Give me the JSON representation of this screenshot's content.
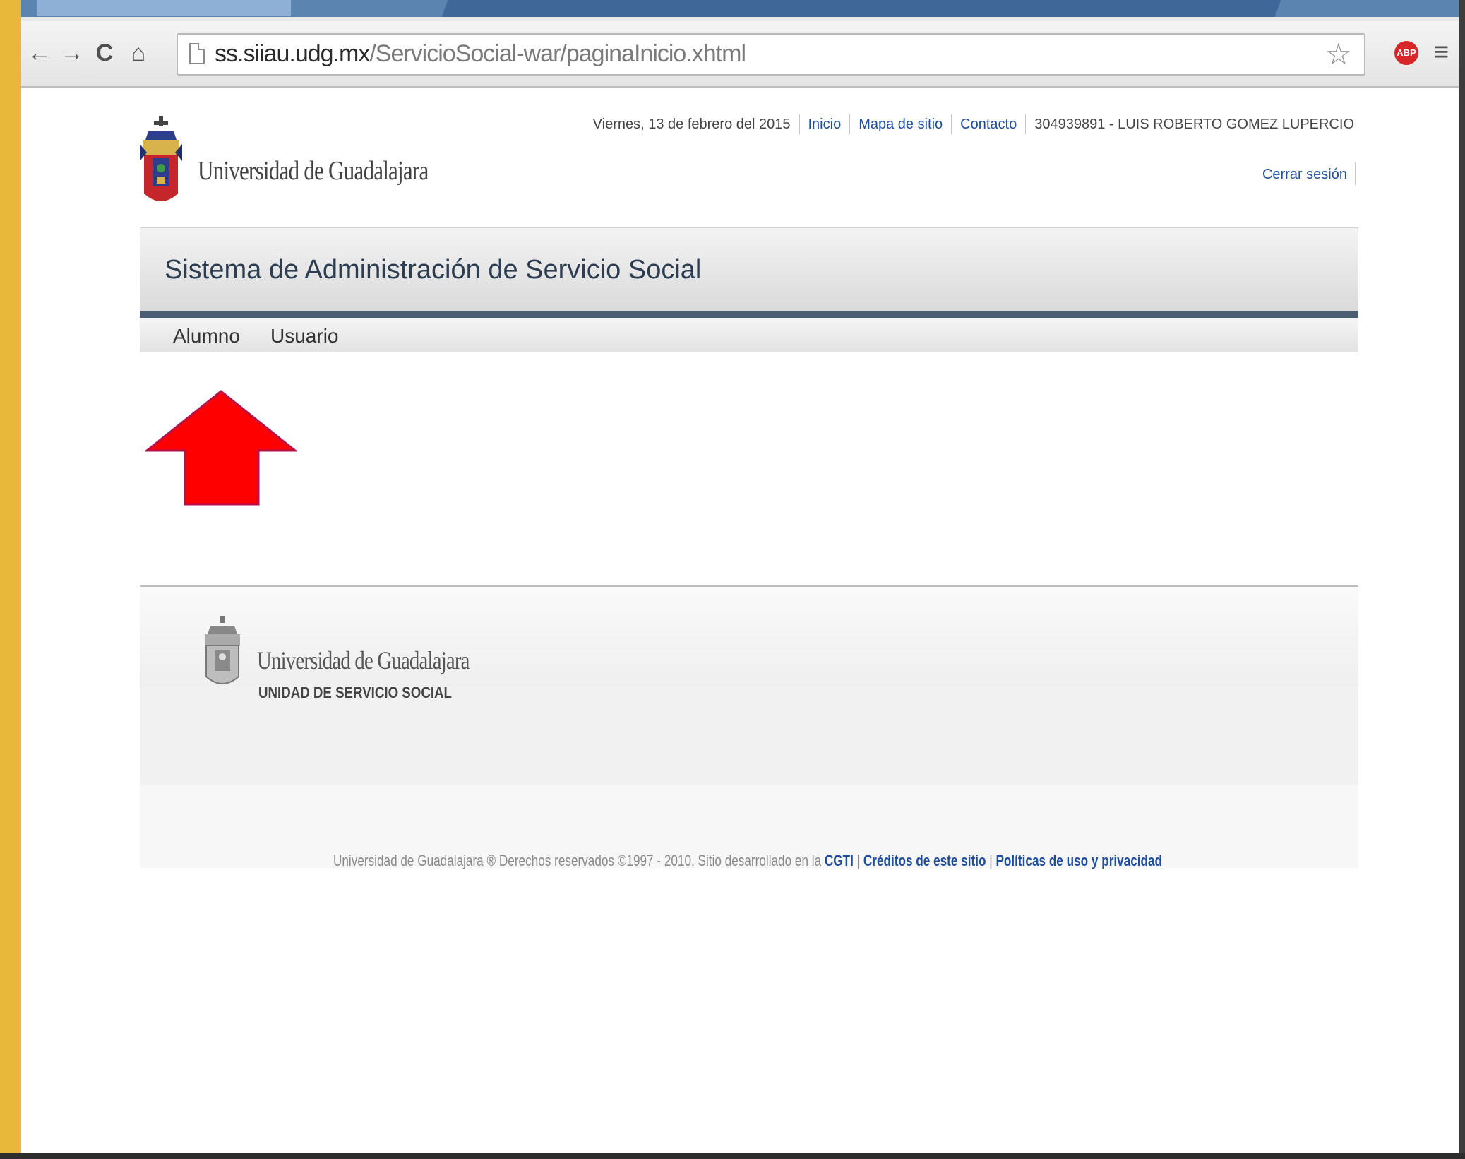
{
  "browser": {
    "url_host": "ss.siiau.udg.mx",
    "url_path": "/ServicioSocial-war/paginaInicio.xhtml",
    "adblock_label": "ABP",
    "nav_icons": [
      "back-arrow-icon",
      "forward-arrow-icon",
      "reload-icon",
      "home-icon"
    ],
    "back": "←",
    "forward": "→",
    "reload": "C",
    "home": "⌂",
    "star": "☆",
    "menu": "≡"
  },
  "header": {
    "university": "Universidad de Guadalajara",
    "date": "Viernes, 13 de febrero del 2015",
    "links": [
      "Inicio",
      "Mapa de sitio",
      "Contacto"
    ],
    "user": "304939891 - LUIS ROBERTO GOMEZ LUPERCIO",
    "logout": "Cerrar sesión"
  },
  "system": {
    "title": "Sistema de Administración de Servicio Social",
    "menu": [
      "Alumno",
      "Usuario"
    ]
  },
  "annotation": {
    "arrow_color": "#ff0000",
    "arrow_points_to": "Alumno"
  },
  "footer": {
    "university": "Universidad de Guadalajara",
    "unit": "UNIDAD DE SERVICIO SOCIAL",
    "copyright": "Universidad de Guadalajara ® Derechos reservados ©1997 - 2010. Sitio desarrollado en la",
    "cgti": "CGTI",
    "credits": "Créditos de este sitio",
    "privacy": "Políticas de uso y privacidad",
    "sep": "|"
  },
  "colors": {
    "frame": "#e8b83a",
    "link": "#1f4e9e",
    "banner_rule": "#4a5d72"
  }
}
